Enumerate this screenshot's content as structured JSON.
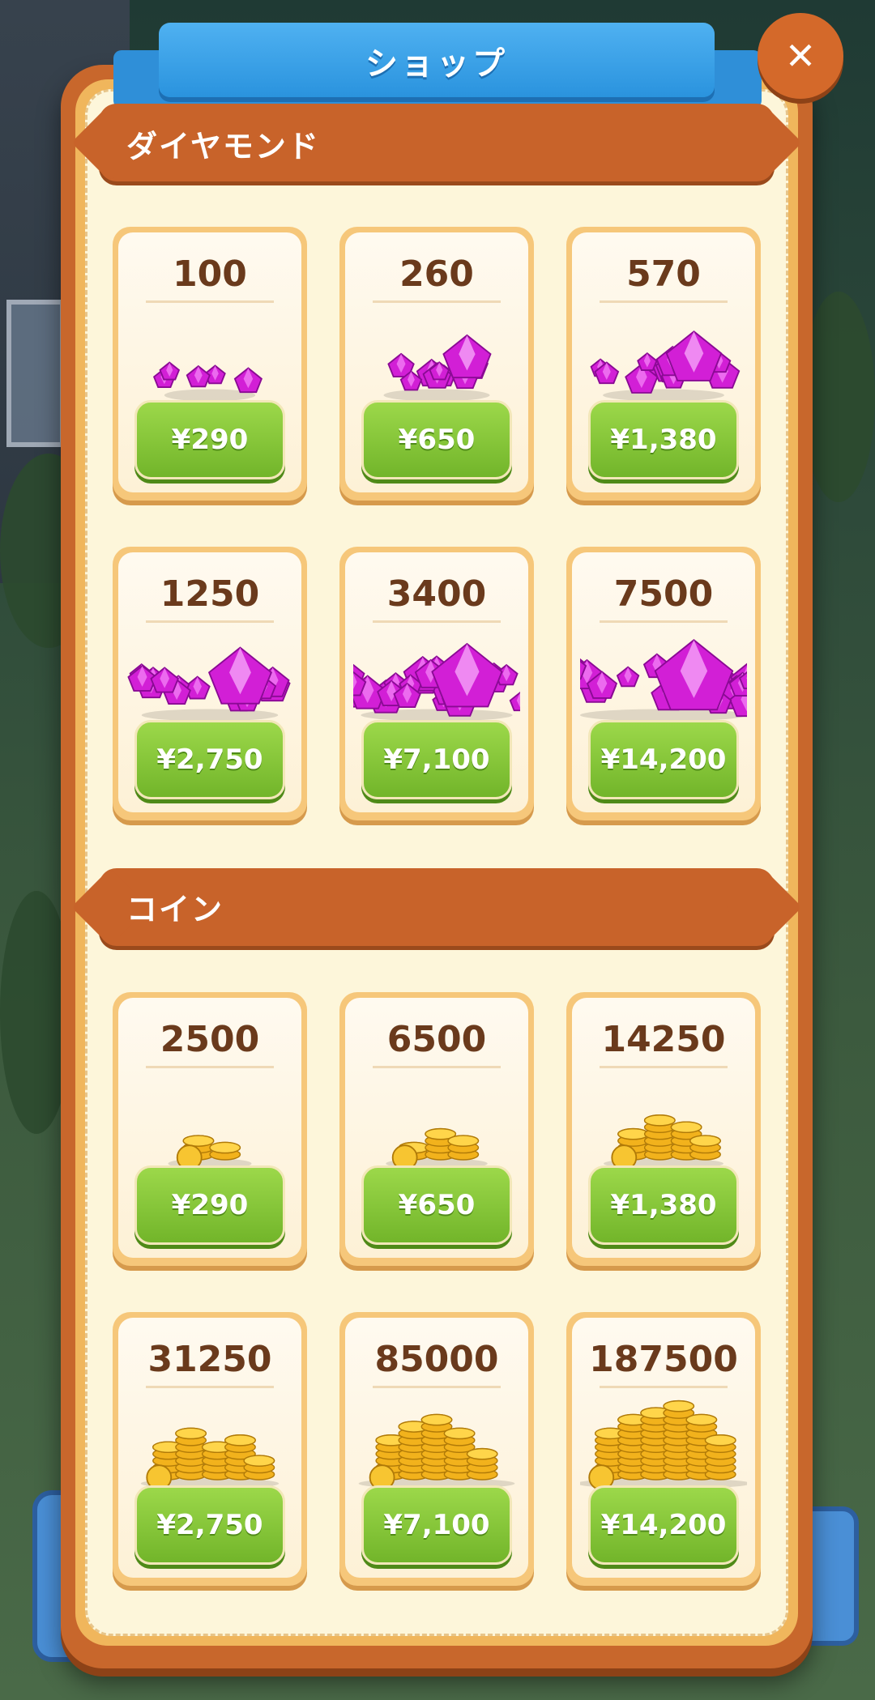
{
  "title": "ショップ",
  "sections": {
    "diamonds": {
      "title": "ダイヤモンド",
      "items": [
        {
          "amount": "100",
          "price": "¥290",
          "icon": "diamond-pile-icon"
        },
        {
          "amount": "260",
          "price": "¥650",
          "icon": "diamond-pile-icon"
        },
        {
          "amount": "570",
          "price": "¥1,380",
          "icon": "diamond-pile-icon"
        },
        {
          "amount": "1250",
          "price": "¥2,750",
          "icon": "diamond-pile-icon"
        },
        {
          "amount": "3400",
          "price": "¥7,100",
          "icon": "diamond-pile-icon"
        },
        {
          "amount": "7500",
          "price": "¥14,200",
          "icon": "diamond-pile-icon"
        }
      ]
    },
    "coins": {
      "title": "コイン",
      "items": [
        {
          "amount": "2500",
          "price": "¥290",
          "icon": "coin-stack-icon"
        },
        {
          "amount": "6500",
          "price": "¥650",
          "icon": "coin-stack-icon"
        },
        {
          "amount": "14250",
          "price": "¥1,380",
          "icon": "coin-stack-icon"
        },
        {
          "amount": "31250",
          "price": "¥2,750",
          "icon": "coin-stack-icon"
        },
        {
          "amount": "85000",
          "price": "¥7,100",
          "icon": "coin-stack-icon"
        },
        {
          "amount": "187500",
          "price": "¥14,200",
          "icon": "coin-stack-icon"
        }
      ]
    }
  },
  "colors": {
    "panel": "#c8672c",
    "cream": "#fdf6da",
    "ribbon": "#2a93de",
    "price_button": "#72b52a",
    "diamond": "#d21fd6",
    "coin": "#f2b21c"
  }
}
